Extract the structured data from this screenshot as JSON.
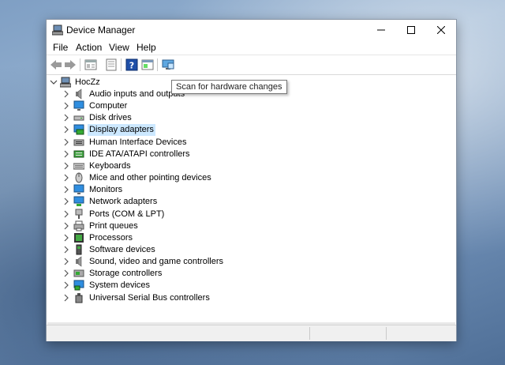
{
  "window": {
    "title": "Device Manager"
  },
  "menu": [
    "File",
    "Action",
    "View",
    "Help"
  ],
  "toolbar": {
    "buttons": [
      "back-arrow-icon",
      "forward-arrow-icon",
      "properties-icon",
      "update-driver-icon",
      "help-icon",
      "show-hidden-icon",
      "scan-hardware-icon"
    ]
  },
  "tooltip": {
    "text": "Scan for hardware changes"
  },
  "tree": {
    "root": "HocZz",
    "items": [
      {
        "label": "Audio inputs and outputs",
        "icon": "speaker-icon"
      },
      {
        "label": "Computer",
        "icon": "monitor-icon"
      },
      {
        "label": "Disk drives",
        "icon": "disk-drive-icon"
      },
      {
        "label": "Display adapters",
        "icon": "display-adapter-icon",
        "selected": true
      },
      {
        "label": "Human Interface Devices",
        "icon": "hid-icon"
      },
      {
        "label": "IDE ATA/ATAPI controllers",
        "icon": "ide-controller-icon"
      },
      {
        "label": "Keyboards",
        "icon": "keyboard-icon"
      },
      {
        "label": "Mice and other pointing devices",
        "icon": "mouse-icon"
      },
      {
        "label": "Monitors",
        "icon": "monitor-icon"
      },
      {
        "label": "Network adapters",
        "icon": "network-adapter-icon"
      },
      {
        "label": "Ports (COM & LPT)",
        "icon": "port-icon"
      },
      {
        "label": "Print queues",
        "icon": "printer-icon"
      },
      {
        "label": "Processors",
        "icon": "processor-icon"
      },
      {
        "label": "Software devices",
        "icon": "software-device-icon"
      },
      {
        "label": "Sound, video and game controllers",
        "icon": "speaker-icon"
      },
      {
        "label": "Storage controllers",
        "icon": "storage-controller-icon"
      },
      {
        "label": "System devices",
        "icon": "system-device-icon"
      },
      {
        "label": "Universal Serial Bus controllers",
        "icon": "usb-icon"
      }
    ]
  },
  "colors": {
    "selection": "#cce8ff",
    "accent": "#0078d7"
  }
}
